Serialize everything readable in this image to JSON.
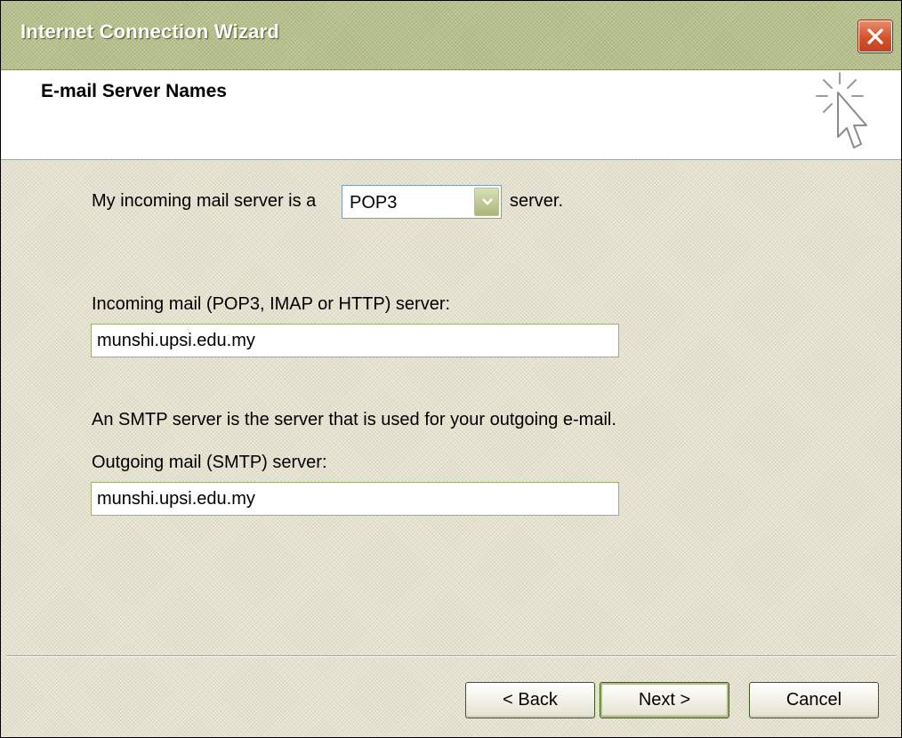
{
  "window": {
    "title": "Internet Connection Wizard"
  },
  "header": {
    "title": "E-mail Server Names",
    "icon": "wizard-cursor-icon"
  },
  "form": {
    "server_type_prefix": "My incoming mail server is a",
    "server_type_value": "POP3",
    "server_type_suffix": "server.",
    "incoming_label": "Incoming mail (POP3, IMAP or HTTP) server:",
    "incoming_value": "munshi.upsi.edu.my",
    "smtp_note": "An SMTP server is the server that is used for your outgoing e-mail.",
    "outgoing_label": "Outgoing mail (SMTP) server:",
    "outgoing_value": "munshi.upsi.edu.my"
  },
  "buttons": {
    "back": "< Back",
    "next": "Next >",
    "cancel": "Cancel"
  },
  "colors": {
    "titlebar": "#b7c18d",
    "dialog_background": "#ece9d8",
    "close_button": "#d4532c"
  }
}
